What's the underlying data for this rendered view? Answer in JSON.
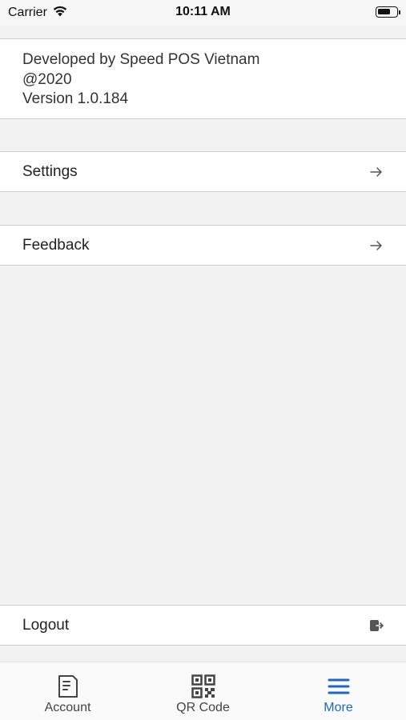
{
  "status_bar": {
    "carrier": "Carrier",
    "time": "10:11 AM",
    "battery_level": 0.7
  },
  "about": {
    "developer": "Developed by Speed POS Vietnam",
    "year": "@2020",
    "version": "Version 1.0.184"
  },
  "menu": {
    "settings_label": "Settings",
    "feedback_label": "Feedback",
    "logout_label": "Logout"
  },
  "tab_bar": {
    "tabs": [
      {
        "label": "Account",
        "icon": "document-icon",
        "active": false
      },
      {
        "label": "QR Code",
        "icon": "qr-code-icon",
        "active": false
      },
      {
        "label": "More",
        "icon": "menu-icon",
        "active": true
      }
    ]
  },
  "colors": {
    "accent": "#1f66c2",
    "background": "#f2f2f2",
    "surface": "#ffffff"
  }
}
